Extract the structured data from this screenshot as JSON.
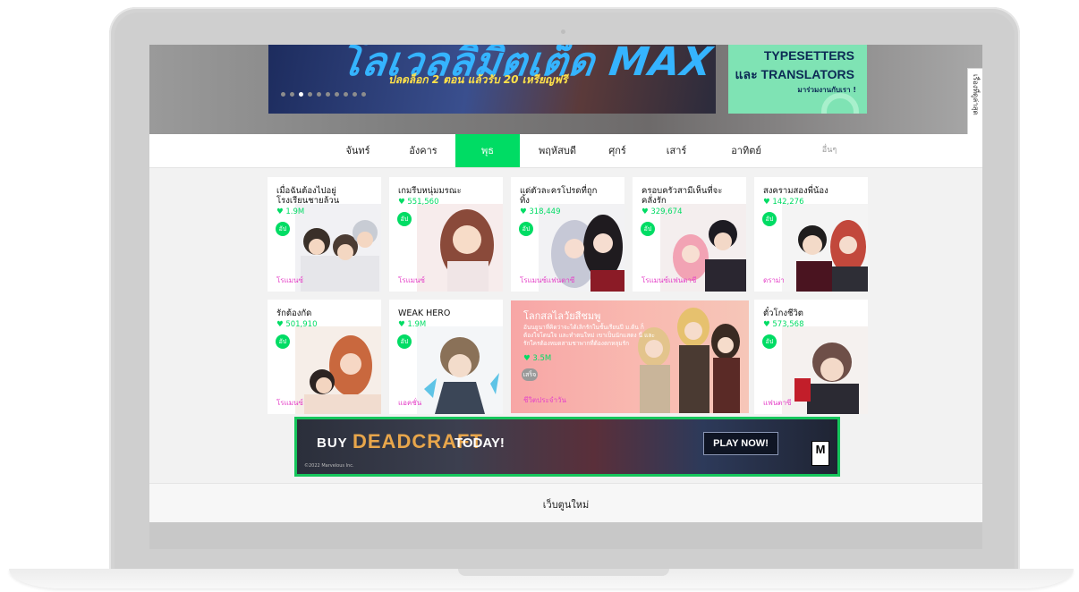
{
  "hero": {
    "banner_title": "โลเวลลิมิตเต็ด MAX",
    "banner_subtitle": "ปลดล็อก 2 ตอน แล้วรับ 20 เหรียญฟรี",
    "recruit_line1": "TYPESETTERS",
    "recruit_line2": "และ TRANSLATORS",
    "recruit_line3": "มาร่วมงานกับเรา !",
    "side_tab": "เรื่องที่ดูล่าสุด",
    "side_tab_arrow": "‹"
  },
  "days": {
    "items": [
      "จันทร์",
      "อังคาร",
      "พุธ",
      "พฤหัสบดี",
      "ศุกร์",
      "เสาร์",
      "อาทิตย์"
    ],
    "active": "พุธ",
    "more": "อื่นๆ"
  },
  "cards": [
    {
      "title": "เมื่อฉันต้องไปอยู่โรงเรียนชายล้วน",
      "likes": "1.9M",
      "badge": "อัป",
      "genre": "โรแมนซ์"
    },
    {
      "title": "เกมรีบหนุ่มมรณะ",
      "likes": "551,560",
      "badge": "อัป",
      "genre": "โรแมนซ์"
    },
    {
      "title": "แด่ตัวละครโปรดที่ถูกทิ้ง",
      "likes": "318,449",
      "badge": "อัป",
      "genre": "โรแมนซ์แฟนตาซี"
    },
    {
      "title": "ครอบครัวสามีเห็นที่จะคลั่งรัก",
      "likes": "329,674",
      "badge": "อัป",
      "genre": "โรแมนซ์แฟนตาซี"
    },
    {
      "title": "สงครามสองพี่น้อง",
      "likes": "142,276",
      "badge": "อัป",
      "genre": "ดราม่า"
    },
    {
      "title": "รักต้องกัด",
      "likes": "501,910",
      "badge": "อัป",
      "genre": "โรแมนซ์"
    },
    {
      "title": "WEAK HERO",
      "likes": "1.9M",
      "badge": "อัป",
      "genre": "แอคชั่น"
    },
    {
      "title": "ตั๋วโกงชีวิต",
      "likes": "573,568",
      "badge": "อัป",
      "genre": "แฟนตาซี"
    }
  ],
  "feature": {
    "title": "โลกสลไลวัยสีชมพู",
    "description": "อันนยูนาที่คิดว่าจะได้เลิกรักในชั้นเรียนปี ม.ต้น ก็ต้องใจโดนใจ และทำตนใหม่ เขาเป็นนักแสดง นี่ และรักใครต้องหมดสามชาพากที่ต้องตกหลุมรัก",
    "likes": "3.5M",
    "badge": "เสร็จ",
    "genre": "ชีวิตประจำวัน"
  },
  "ad": {
    "buy": "BUY",
    "game": "DEADCRAFT",
    "today": "TODAY!",
    "play": "PLAY NOW!",
    "copyright": "©2022 Marvelous Inc.",
    "rating": "M"
  },
  "footer": {
    "label": "เว็บตูนใหม่"
  },
  "colors": {
    "accent": "#00dc64",
    "genre": "#e542c8",
    "ad_border": "#16c65c"
  }
}
